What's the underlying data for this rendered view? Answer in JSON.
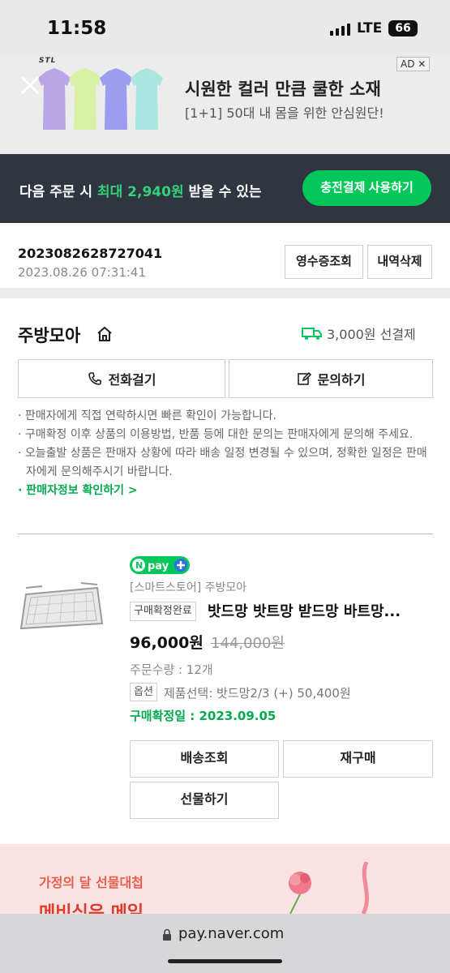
{
  "status_bar": {
    "time": "11:58",
    "network": "LTE",
    "battery": "66"
  },
  "ad": {
    "brand": "STL",
    "title": "시원한 컬러 만큼 쿨한 소재",
    "subtitle": "[1+1] 50대 내 몸을 위한 안심원단!",
    "badge": "AD ✕",
    "shirt_colors": [
      "#b9a6e6",
      "#d9f0a6",
      "#9c9cf0",
      "#a9e6df"
    ]
  },
  "cashback": {
    "prefix": "다음 주문 시 ",
    "highlight": "최대 2,940원",
    "suffix": " 받을 수 있는",
    "button": "충전결제 사용하기",
    "accent": "#03c75a"
  },
  "order": {
    "number": "2023082628727041",
    "date": "2023.08.26 07:31:41",
    "receipt_button": "영수증조회",
    "delete_button": "내역삭제"
  },
  "store": {
    "name": "주방모아",
    "shipping": "3,000원 선결제",
    "call_button": "전화걸기",
    "inquiry_button": "문의하기",
    "notices": [
      "· 판매자에게 직접 연락하시면 빠른 확인이 가능합니다.",
      "· 구매확정 이후 상품의 이용방법, 반품 등에 대한 문의는 판매자에게 문의해 주세요.",
      "· 오늘출발 상품은 판매자 상황에 따라 배송 일정 변경될 수 있으며, 정확한 일정은 판매자에게 문의해주시기 바랍니다."
    ],
    "seller_info_link": "· 판매자정보 확인하기 >"
  },
  "product": {
    "npay_label": "N pay",
    "store_tag": "[스마트스토어] 주방모아",
    "status": "구매확정완료",
    "title": "밧드망 밧트망 받드망 바트망...",
    "price": "96,000원",
    "original_price": "144,000원",
    "quantity": "주문수량 : 12개",
    "option_tag": "옵션",
    "option": "제품선택: 밧드망2/3 (+) 50,400원",
    "confirm_date": "구매확정일 : 2023.09.05",
    "track_button": "배송조회",
    "rebuy_button": "재구매",
    "gift_button": "선물하기"
  },
  "promo": {
    "line1": "가정의 달 선물대첩",
    "line2": "메비식은 메일"
  },
  "browser": {
    "url": "pay.naver.com"
  }
}
